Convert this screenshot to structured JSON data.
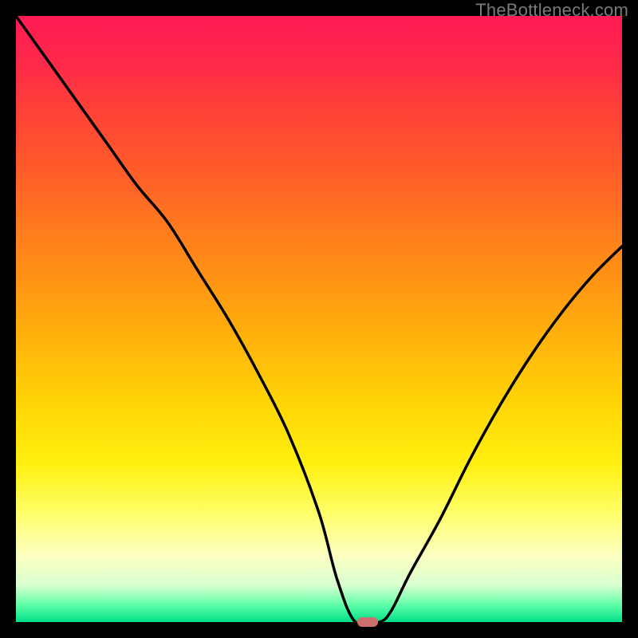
{
  "watermark": "TheBottleneck.com",
  "chart_data": {
    "type": "line",
    "title": "",
    "xlabel": "",
    "ylabel": "",
    "xlim": [
      0,
      100
    ],
    "ylim": [
      0,
      100
    ],
    "x": [
      0,
      5,
      10,
      15,
      20,
      25,
      30,
      35,
      40,
      45,
      50,
      53,
      56,
      60,
      62,
      65,
      70,
      75,
      80,
      85,
      90,
      95,
      100
    ],
    "values": [
      100,
      93,
      86,
      79,
      72,
      66,
      58,
      50,
      41,
      31,
      18,
      7,
      0,
      0,
      2,
      8,
      17,
      27,
      36,
      44,
      51,
      57,
      62
    ],
    "marker": {
      "x": 58,
      "y": 0
    }
  },
  "colors": {
    "curve": "#000000",
    "marker": "#ce6d6d",
    "frame": "#000000"
  }
}
